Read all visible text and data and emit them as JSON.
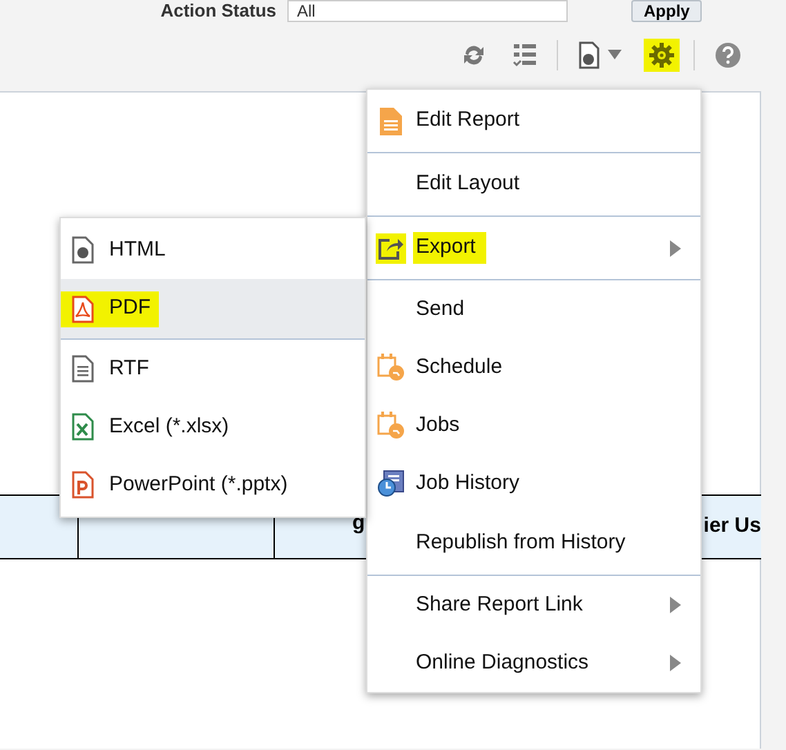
{
  "filter": {
    "label": "Action Status",
    "value": "All",
    "button": "Apply"
  },
  "toolbar": [
    {
      "kind": "refresh",
      "highlighted": false
    },
    {
      "kind": "list",
      "highlighted": false
    },
    {
      "kind": "output",
      "highlighted": false
    },
    {
      "kind": "gear",
      "highlighted": true
    },
    {
      "kind": "help",
      "highlighted": false
    }
  ],
  "table": {
    "columns": [
      "",
      "",
      "g",
      "ier Us"
    ]
  },
  "menu": {
    "items": [
      {
        "label": "Edit Report",
        "kind": "report",
        "highlighted": false,
        "submenu": false,
        "divider_after": true
      },
      {
        "label": "Edit Layout",
        "kind": "none",
        "highlighted": false,
        "submenu": false,
        "divider_after": true
      },
      {
        "label": "Export",
        "kind": "export",
        "highlighted": true,
        "submenu": true,
        "divider_after": true
      },
      {
        "label": "Send",
        "kind": "none",
        "highlighted": false,
        "submenu": false,
        "divider_after": false
      },
      {
        "label": "Schedule",
        "kind": "calendar",
        "highlighted": false,
        "submenu": false,
        "divider_after": false
      },
      {
        "label": "Jobs",
        "kind": "calendar",
        "highlighted": false,
        "submenu": false,
        "divider_after": false
      },
      {
        "label": "Job History",
        "kind": "history",
        "highlighted": false,
        "submenu": false,
        "divider_after": false
      },
      {
        "label": "Republish from History",
        "kind": "none",
        "highlighted": false,
        "submenu": false,
        "divider_after": true
      },
      {
        "label": "Share Report Link",
        "kind": "none",
        "highlighted": false,
        "submenu": true,
        "divider_after": false
      },
      {
        "label": "Online Diagnostics",
        "kind": "none",
        "highlighted": false,
        "submenu": true,
        "divider_after": false
      }
    ]
  },
  "export_menu": {
    "items": [
      {
        "label": "HTML",
        "kind": "html",
        "selected": false,
        "highlighted": false,
        "divider_after": false
      },
      {
        "label": "PDF",
        "kind": "pdf",
        "selected": true,
        "highlighted": true,
        "divider_after": true
      },
      {
        "label": "RTF",
        "kind": "rtf",
        "selected": false,
        "highlighted": false,
        "divider_after": false
      },
      {
        "label": "Excel (*.xlsx)",
        "kind": "excel",
        "selected": false,
        "highlighted": false,
        "divider_after": false
      },
      {
        "label": "PowerPoint (*.pptx)",
        "kind": "ppt",
        "selected": false,
        "highlighted": false,
        "divider_after": false
      }
    ]
  }
}
